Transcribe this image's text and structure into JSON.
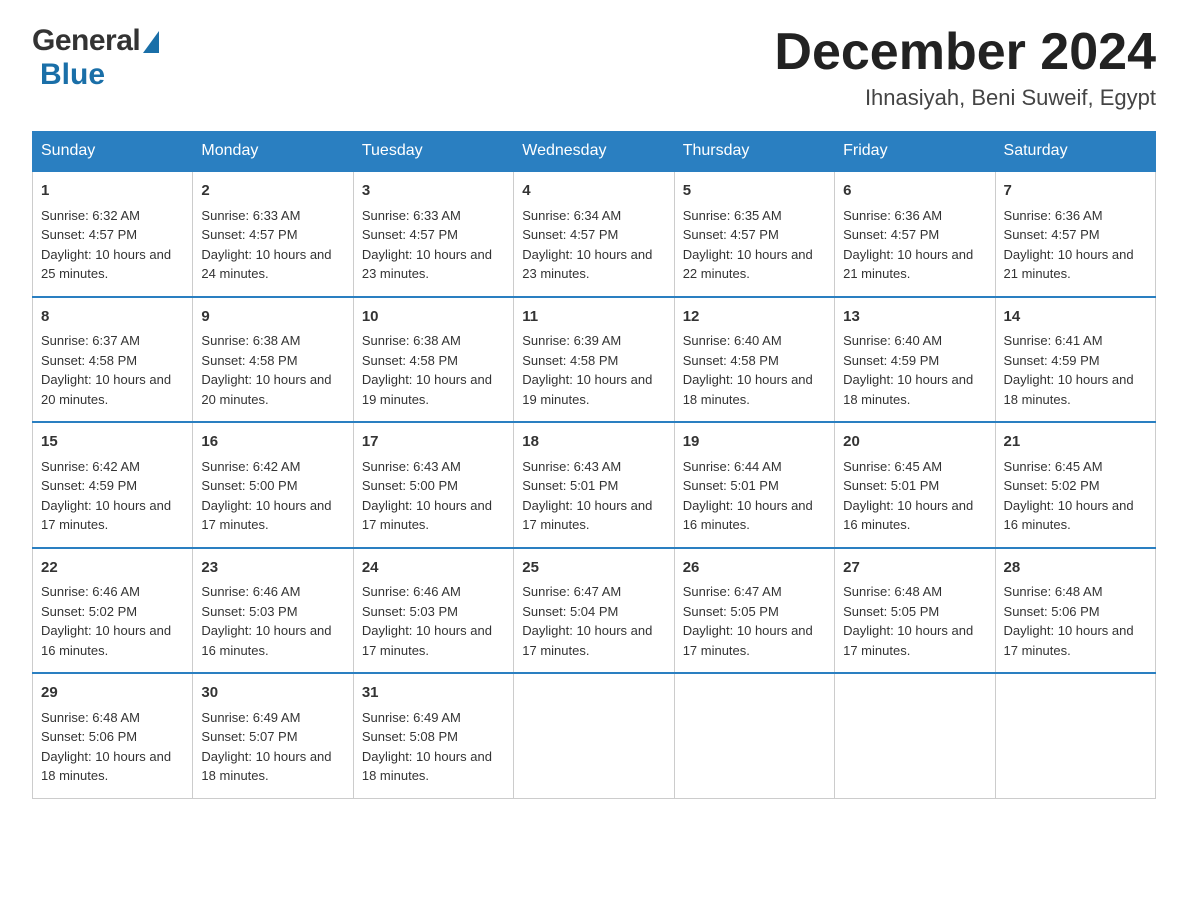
{
  "header": {
    "title": "December 2024",
    "location": "Ihnasiyah, Beni Suweif, Egypt",
    "logo_general": "General",
    "logo_blue": "Blue"
  },
  "days_of_week": [
    "Sunday",
    "Monday",
    "Tuesday",
    "Wednesday",
    "Thursday",
    "Friday",
    "Saturday"
  ],
  "weeks": [
    [
      {
        "day": "1",
        "sunrise": "6:32 AM",
        "sunset": "4:57 PM",
        "daylight": "10 hours and 25 minutes."
      },
      {
        "day": "2",
        "sunrise": "6:33 AM",
        "sunset": "4:57 PM",
        "daylight": "10 hours and 24 minutes."
      },
      {
        "day": "3",
        "sunrise": "6:33 AM",
        "sunset": "4:57 PM",
        "daylight": "10 hours and 23 minutes."
      },
      {
        "day": "4",
        "sunrise": "6:34 AM",
        "sunset": "4:57 PM",
        "daylight": "10 hours and 23 minutes."
      },
      {
        "day": "5",
        "sunrise": "6:35 AM",
        "sunset": "4:57 PM",
        "daylight": "10 hours and 22 minutes."
      },
      {
        "day": "6",
        "sunrise": "6:36 AM",
        "sunset": "4:57 PM",
        "daylight": "10 hours and 21 minutes."
      },
      {
        "day": "7",
        "sunrise": "6:36 AM",
        "sunset": "4:57 PM",
        "daylight": "10 hours and 21 minutes."
      }
    ],
    [
      {
        "day": "8",
        "sunrise": "6:37 AM",
        "sunset": "4:58 PM",
        "daylight": "10 hours and 20 minutes."
      },
      {
        "day": "9",
        "sunrise": "6:38 AM",
        "sunset": "4:58 PM",
        "daylight": "10 hours and 20 minutes."
      },
      {
        "day": "10",
        "sunrise": "6:38 AM",
        "sunset": "4:58 PM",
        "daylight": "10 hours and 19 minutes."
      },
      {
        "day": "11",
        "sunrise": "6:39 AM",
        "sunset": "4:58 PM",
        "daylight": "10 hours and 19 minutes."
      },
      {
        "day": "12",
        "sunrise": "6:40 AM",
        "sunset": "4:58 PM",
        "daylight": "10 hours and 18 minutes."
      },
      {
        "day": "13",
        "sunrise": "6:40 AM",
        "sunset": "4:59 PM",
        "daylight": "10 hours and 18 minutes."
      },
      {
        "day": "14",
        "sunrise": "6:41 AM",
        "sunset": "4:59 PM",
        "daylight": "10 hours and 18 minutes."
      }
    ],
    [
      {
        "day": "15",
        "sunrise": "6:42 AM",
        "sunset": "4:59 PM",
        "daylight": "10 hours and 17 minutes."
      },
      {
        "day": "16",
        "sunrise": "6:42 AM",
        "sunset": "5:00 PM",
        "daylight": "10 hours and 17 minutes."
      },
      {
        "day": "17",
        "sunrise": "6:43 AM",
        "sunset": "5:00 PM",
        "daylight": "10 hours and 17 minutes."
      },
      {
        "day": "18",
        "sunrise": "6:43 AM",
        "sunset": "5:01 PM",
        "daylight": "10 hours and 17 minutes."
      },
      {
        "day": "19",
        "sunrise": "6:44 AM",
        "sunset": "5:01 PM",
        "daylight": "10 hours and 16 minutes."
      },
      {
        "day": "20",
        "sunrise": "6:45 AM",
        "sunset": "5:01 PM",
        "daylight": "10 hours and 16 minutes."
      },
      {
        "day": "21",
        "sunrise": "6:45 AM",
        "sunset": "5:02 PM",
        "daylight": "10 hours and 16 minutes."
      }
    ],
    [
      {
        "day": "22",
        "sunrise": "6:46 AM",
        "sunset": "5:02 PM",
        "daylight": "10 hours and 16 minutes."
      },
      {
        "day": "23",
        "sunrise": "6:46 AM",
        "sunset": "5:03 PM",
        "daylight": "10 hours and 16 minutes."
      },
      {
        "day": "24",
        "sunrise": "6:46 AM",
        "sunset": "5:03 PM",
        "daylight": "10 hours and 17 minutes."
      },
      {
        "day": "25",
        "sunrise": "6:47 AM",
        "sunset": "5:04 PM",
        "daylight": "10 hours and 17 minutes."
      },
      {
        "day": "26",
        "sunrise": "6:47 AM",
        "sunset": "5:05 PM",
        "daylight": "10 hours and 17 minutes."
      },
      {
        "day": "27",
        "sunrise": "6:48 AM",
        "sunset": "5:05 PM",
        "daylight": "10 hours and 17 minutes."
      },
      {
        "day": "28",
        "sunrise": "6:48 AM",
        "sunset": "5:06 PM",
        "daylight": "10 hours and 17 minutes."
      }
    ],
    [
      {
        "day": "29",
        "sunrise": "6:48 AM",
        "sunset": "5:06 PM",
        "daylight": "10 hours and 18 minutes."
      },
      {
        "day": "30",
        "sunrise": "6:49 AM",
        "sunset": "5:07 PM",
        "daylight": "10 hours and 18 minutes."
      },
      {
        "day": "31",
        "sunrise": "6:49 AM",
        "sunset": "5:08 PM",
        "daylight": "10 hours and 18 minutes."
      },
      null,
      null,
      null,
      null
    ]
  ],
  "labels": {
    "sunrise": "Sunrise:",
    "sunset": "Sunset:",
    "daylight": "Daylight:"
  },
  "colors": {
    "header_bg": "#2a7fc1",
    "header_text": "#ffffff",
    "border_top": "#2a7fc1",
    "text": "#333333"
  }
}
